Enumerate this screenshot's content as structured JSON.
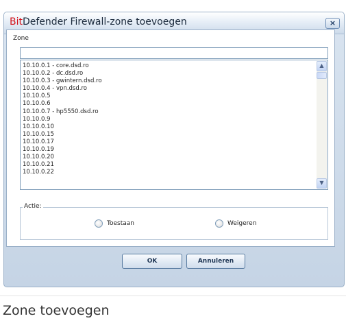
{
  "dialog": {
    "title_brand": "Bit",
    "title_rest": "Defender Firewall-zone toevoegen",
    "close_label": "×"
  },
  "zone": {
    "label": "Zone",
    "value": "",
    "items": [
      "10.10.0.1 - core.dsd.ro",
      "10.10.0.2 - dc.dsd.ro",
      "10.10.0.3 - gwintern.dsd.ro",
      "10.10.0.4 - vpn.dsd.ro",
      "10.10.0.5",
      "10.10.0.6",
      "10.10.0.7 - hp5550.dsd.ro",
      "10.10.0.9",
      "10.10.0.10",
      "10.10.0.15",
      "10.10.0.17",
      "10.10.0.19",
      "10.10.0.20",
      "10.10.0.21",
      "10.10.0.22"
    ]
  },
  "action": {
    "legend": "Actie:",
    "allow_label": "Toestaan",
    "deny_label": "Weigeren"
  },
  "buttons": {
    "ok_label": "OK",
    "cancel_label": "Annuleren"
  },
  "caption": "Zone toevoegen",
  "colors": {
    "brand_red": "#d4141c",
    "dialog_bg": "#cfdbe9"
  }
}
